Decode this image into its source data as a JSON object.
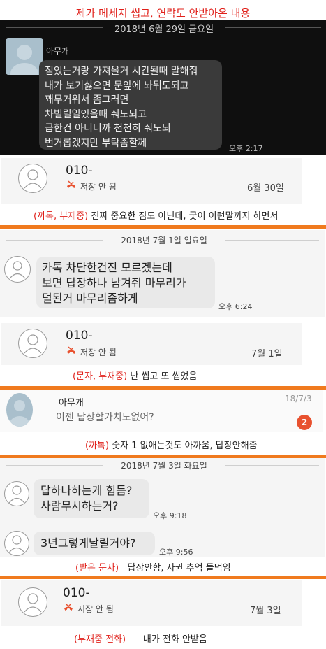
{
  "header_title": "제가 메세지 씹고, 연락도 안받아온 내용",
  "dark_chat": {
    "date": "2018년 6월 29일 금요일",
    "sender": "아무개",
    "lines": [
      "짐있는거랑 가져올거 시간될때 말해줘",
      "내가 보기싫으면 문앞에 놔둬도되고",
      "꽤무거워서 좀그러면",
      "차빌릴일있을때 줘도되고",
      "급한건 아니니까 천천히 줘도되",
      "번거롭겠지만 부탁좀할께"
    ],
    "time": "오후 2:17"
  },
  "call1": {
    "number": "010-",
    "status": "저장 안 됨",
    "date": "6월 30일"
  },
  "caption1": {
    "tag": "(까톡, 부재중)",
    "text": " 진짜 중요한 짐도 아닌데, 굿이 이런말까지 하면서"
  },
  "chat2": {
    "date": "2018년 7월 1일 일요일",
    "lines": [
      "카톡 차단한건진 모르겠는데",
      "보면 답장하나 남겨줘 마무리가",
      "덜된거 마무리좀하게"
    ],
    "time": "오후 6:24"
  },
  "call2": {
    "number": "010-",
    "status": "저장 안 됨",
    "date": "7월 1일"
  },
  "caption2": {
    "tag": "(문자, 부재중)",
    "text": " 난 씹고 또 씹었음"
  },
  "preview": {
    "sender": "아무개",
    "message": "이젠 답장할가치도없어?",
    "date": "18/7/3",
    "badge": "2"
  },
  "caption3": {
    "tag": "(까톡)",
    "text": " 숫자 1 없애는것도 아까움, 답장안해줌"
  },
  "chat3": {
    "date": "2018년 7월 3일 화요일",
    "msg1_lines": [
      "답하나하는게 힘듬?",
      "사람무시하는거?"
    ],
    "msg1_time": "오후 9:18",
    "msg2": "3년그렇게날릴거야?",
    "msg2_time": "오후 9:56"
  },
  "caption4": {
    "tag": "(받은 문자)",
    "text": "   답장안함, 사귄 추억 들먹임"
  },
  "call3": {
    "number": "010-",
    "status": "저장 안 됨",
    "date": "7월 3일"
  },
  "caption5": {
    "tag": "(부재중 전화)",
    "text": "      내가 전화 안받음"
  },
  "colors": {
    "accent": "#f07a1e",
    "red": "#e0201a",
    "badge": "#e8512f"
  }
}
